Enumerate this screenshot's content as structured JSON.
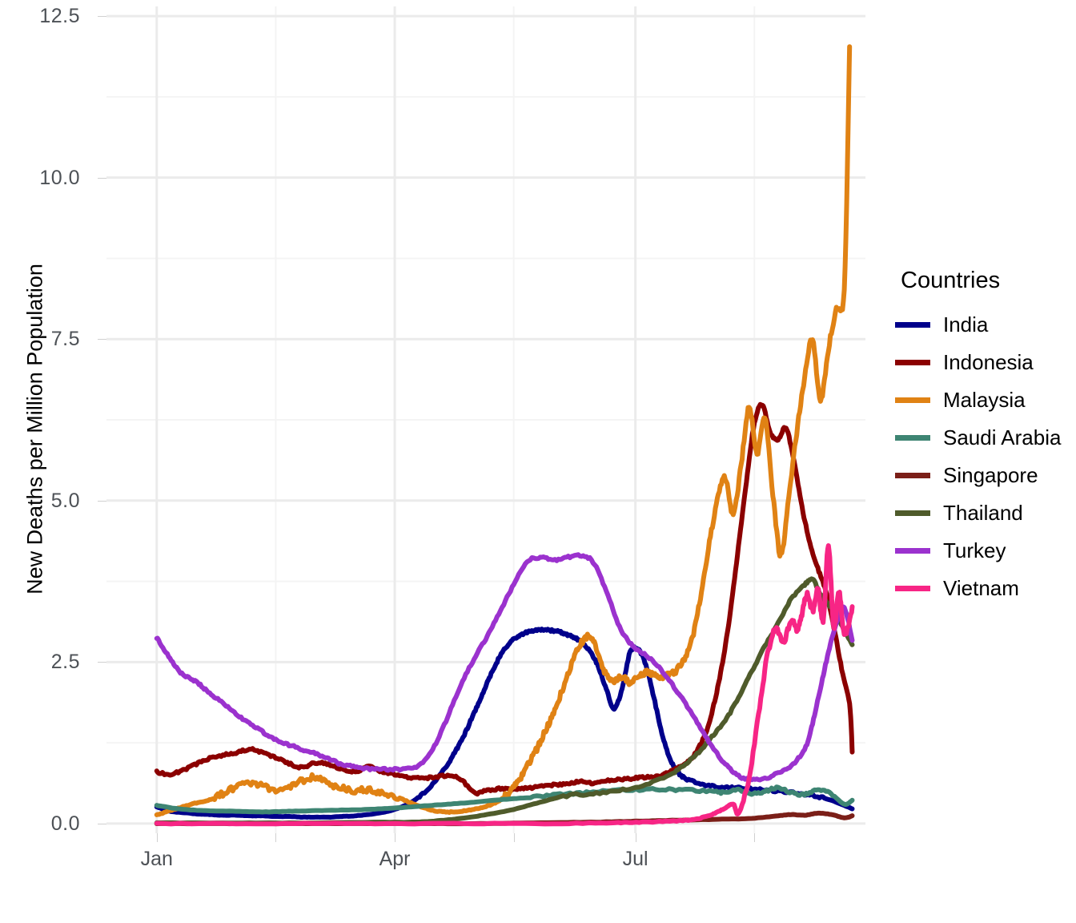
{
  "chart_data": {
    "type": "line",
    "title": "",
    "xlabel": "",
    "ylabel": "New Deaths per Million Population",
    "ylim": [
      -0.15,
      12.65
    ],
    "yticks": [
      "0.0",
      "2.5",
      "5.0",
      "7.5",
      "10.0",
      "12.5"
    ],
    "ytick_values": [
      0.0,
      2.5,
      5.0,
      7.5,
      10.0,
      12.5
    ],
    "minor_ytick_values": [
      1.25,
      3.75,
      6.25,
      8.75,
      11.25
    ],
    "xticks": [
      "Jan",
      "Apr",
      "Jul"
    ],
    "xtick_positions": [
      0,
      90,
      181
    ],
    "minor_xtick_positions": [
      45,
      135,
      226
    ],
    "xlim": [
      -19,
      268
    ],
    "grid": true,
    "legend_position": "right",
    "legend_title": "Countries",
    "x_unit": "day of year",
    "series": [
      {
        "name": "India",
        "color": "#00008B",
        "x": [
          0,
          5,
          10,
          15,
          20,
          25,
          30,
          35,
          40,
          45,
          50,
          55,
          60,
          65,
          70,
          75,
          80,
          85,
          90,
          95,
          100,
          105,
          110,
          113,
          116,
          119,
          122,
          125,
          128,
          131,
          134,
          137,
          140,
          143,
          146,
          149,
          152,
          155,
          158,
          161,
          164,
          167,
          170,
          173,
          176,
          179,
          182,
          185,
          188,
          191,
          194,
          197,
          200,
          205,
          210,
          215,
          220,
          225,
          230,
          235,
          240,
          245,
          250,
          255,
          260,
          263
        ],
        "values": [
          0.26,
          0.19,
          0.17,
          0.15,
          0.14,
          0.13,
          0.13,
          0.12,
          0.12,
          0.11,
          0.11,
          0.1,
          0.1,
          0.1,
          0.11,
          0.12,
          0.14,
          0.17,
          0.22,
          0.3,
          0.44,
          0.64,
          0.92,
          1.12,
          1.35,
          1.62,
          1.9,
          2.18,
          2.45,
          2.67,
          2.82,
          2.91,
          2.96,
          2.99,
          3.0,
          2.99,
          2.97,
          2.93,
          2.88,
          2.8,
          2.66,
          2.42,
          2.08,
          1.78,
          2.1,
          2.65,
          2.7,
          2.45,
          1.95,
          1.4,
          1.02,
          0.8,
          0.7,
          0.62,
          0.58,
          0.56,
          0.55,
          0.54,
          0.52,
          0.5,
          0.48,
          0.45,
          0.42,
          0.36,
          0.28,
          0.23
        ]
      },
      {
        "name": "Indonesia",
        "color": "#8B0000",
        "x": [
          0,
          5,
          10,
          15,
          20,
          25,
          30,
          35,
          40,
          45,
          50,
          55,
          60,
          65,
          70,
          75,
          80,
          85,
          90,
          95,
          100,
          105,
          110,
          115,
          120,
          125,
          130,
          135,
          140,
          145,
          150,
          155,
          160,
          165,
          170,
          175,
          180,
          185,
          190,
          193,
          196,
          199,
          202,
          205,
          208,
          211,
          214,
          217,
          220,
          223,
          226,
          229,
          232,
          235,
          238,
          241,
          244,
          247,
          250,
          253,
          256,
          259,
          262,
          263
        ],
        "values": [
          0.8,
          0.76,
          0.83,
          0.92,
          1.01,
          1.06,
          1.09,
          1.15,
          1.1,
          1.02,
          0.93,
          0.87,
          0.94,
          0.92,
          0.84,
          0.8,
          0.88,
          0.81,
          0.76,
          0.72,
          0.7,
          0.72,
          0.74,
          0.69,
          0.48,
          0.51,
          0.54,
          0.53,
          0.55,
          0.57,
          0.6,
          0.62,
          0.65,
          0.63,
          0.66,
          0.68,
          0.7,
          0.72,
          0.74,
          0.78,
          0.84,
          0.9,
          1.0,
          1.18,
          1.45,
          1.9,
          2.5,
          3.3,
          4.3,
          5.3,
          6.2,
          6.48,
          6.05,
          5.95,
          6.12,
          5.6,
          4.9,
          4.35,
          3.95,
          3.6,
          3.05,
          2.4,
          1.85,
          1.12
        ]
      },
      {
        "name": "Malaysia",
        "color": "#E08214",
        "x": [
          0,
          5,
          10,
          15,
          20,
          25,
          30,
          35,
          40,
          45,
          50,
          55,
          60,
          65,
          70,
          75,
          80,
          85,
          90,
          95,
          100,
          105,
          110,
          115,
          120,
          124,
          128,
          131,
          134,
          137,
          140,
          143,
          146,
          149,
          152,
          155,
          158,
          161,
          164,
          167,
          170,
          173,
          176,
          179,
          182,
          185,
          188,
          191,
          194,
          197,
          200,
          203,
          206,
          209,
          212,
          215,
          218,
          221,
          224,
          227,
          230,
          233,
          236,
          239,
          242,
          245,
          248,
          251,
          254,
          257,
          260,
          262
        ],
        "values": [
          0.13,
          0.2,
          0.26,
          0.32,
          0.37,
          0.46,
          0.56,
          0.62,
          0.58,
          0.52,
          0.58,
          0.66,
          0.72,
          0.62,
          0.55,
          0.5,
          0.53,
          0.48,
          0.42,
          0.34,
          0.26,
          0.2,
          0.18,
          0.19,
          0.22,
          0.26,
          0.32,
          0.4,
          0.52,
          0.68,
          0.88,
          1.1,
          1.35,
          1.62,
          1.92,
          2.25,
          2.6,
          2.82,
          2.9,
          2.62,
          2.3,
          2.2,
          2.28,
          2.18,
          2.28,
          2.34,
          2.32,
          2.28,
          2.3,
          2.4,
          2.6,
          2.95,
          3.6,
          4.35,
          5.0,
          5.35,
          4.8,
          5.55,
          6.45,
          5.7,
          6.3,
          5.1,
          4.15,
          5.05,
          6.05,
          6.9,
          7.5,
          6.55,
          7.35,
          7.95,
          8.3,
          12.05
        ]
      },
      {
        "name": "Saudi Arabia",
        "color": "#3E8573",
        "x": [
          0,
          10,
          20,
          30,
          40,
          50,
          60,
          70,
          80,
          90,
          100,
          110,
          120,
          130,
          140,
          150,
          160,
          170,
          180,
          190,
          200,
          210,
          215,
          220,
          225,
          230,
          235,
          240,
          245,
          250,
          255,
          260,
          263
        ],
        "values": [
          0.28,
          0.22,
          0.2,
          0.19,
          0.18,
          0.19,
          0.2,
          0.21,
          0.22,
          0.24,
          0.27,
          0.3,
          0.33,
          0.37,
          0.4,
          0.44,
          0.47,
          0.5,
          0.52,
          0.53,
          0.52,
          0.5,
          0.48,
          0.52,
          0.46,
          0.5,
          0.55,
          0.48,
          0.45,
          0.52,
          0.46,
          0.3,
          0.36
        ]
      },
      {
        "name": "Singapore",
        "color": "#7B1F18",
        "x": [
          0,
          20,
          40,
          60,
          80,
          100,
          120,
          140,
          160,
          175,
          185,
          195,
          205,
          215,
          225,
          235,
          240,
          245,
          250,
          255,
          260,
          263
        ],
        "values": [
          0.0,
          0.0,
          0.0,
          0.0,
          0.0,
          0.0,
          0.0,
          0.01,
          0.02,
          0.03,
          0.04,
          0.05,
          0.06,
          0.07,
          0.08,
          0.12,
          0.14,
          0.13,
          0.16,
          0.14,
          0.09,
          0.12
        ]
      },
      {
        "name": "Thailand",
        "color": "#4F5B2B",
        "x": [
          0,
          20,
          40,
          60,
          80,
          95,
          105,
          115,
          125,
          135,
          145,
          155,
          165,
          175,
          185,
          195,
          200,
          205,
          210,
          215,
          220,
          225,
          230,
          235,
          240,
          245,
          248,
          251,
          254,
          257,
          260,
          263
        ],
        "values": [
          0.01,
          0.01,
          0.01,
          0.01,
          0.02,
          0.02,
          0.04,
          0.08,
          0.14,
          0.22,
          0.33,
          0.43,
          0.46,
          0.52,
          0.6,
          0.78,
          0.92,
          1.1,
          1.35,
          1.6,
          1.95,
          2.35,
          2.75,
          3.1,
          3.48,
          3.7,
          3.78,
          3.55,
          3.4,
          3.25,
          3.0,
          2.78
        ]
      },
      {
        "name": "Turkey",
        "color": "#9B32CE",
        "x": [
          0,
          4,
          8,
          12,
          16,
          20,
          25,
          30,
          35,
          40,
          45,
          50,
          55,
          60,
          65,
          70,
          75,
          80,
          85,
          90,
          95,
          100,
          105,
          110,
          115,
          120,
          125,
          130,
          135,
          140,
          145,
          150,
          155,
          160,
          165,
          170,
          175,
          180,
          185,
          190,
          195,
          200,
          205,
          210,
          215,
          220,
          225,
          230,
          235,
          240,
          245,
          248,
          251,
          254,
          257,
          260,
          263
        ],
        "values": [
          2.88,
          2.62,
          2.38,
          2.26,
          2.16,
          2.02,
          1.86,
          1.7,
          1.55,
          1.42,
          1.3,
          1.22,
          1.15,
          1.08,
          1.0,
          0.92,
          0.88,
          0.85,
          0.84,
          0.84,
          0.86,
          0.92,
          1.2,
          1.65,
          2.15,
          2.55,
          2.9,
          3.3,
          3.7,
          4.05,
          4.12,
          4.08,
          4.12,
          4.15,
          4.05,
          3.6,
          3.05,
          2.75,
          2.6,
          2.42,
          2.15,
          1.85,
          1.52,
          1.2,
          0.92,
          0.74,
          0.68,
          0.7,
          0.78,
          0.9,
          1.15,
          1.55,
          2.1,
          2.65,
          3.1,
          3.35,
          2.82
        ]
      },
      {
        "name": "Vietnam",
        "color": "#F72585",
        "x": [
          0,
          30,
          60,
          90,
          120,
          150,
          170,
          180,
          190,
          200,
          205,
          210,
          214,
          218,
          220,
          224,
          228,
          231,
          234,
          237,
          240,
          242,
          244,
          246,
          248,
          250,
          252,
          254,
          256,
          258,
          260,
          263
        ],
        "values": [
          0.0,
          0.0,
          0.0,
          0.0,
          0.0,
          0.0,
          0.01,
          0.02,
          0.03,
          0.05,
          0.08,
          0.14,
          0.22,
          0.3,
          0.16,
          0.7,
          1.8,
          2.62,
          3.0,
          2.82,
          3.15,
          3.0,
          3.25,
          3.55,
          3.3,
          3.62,
          3.15,
          4.28,
          3.05,
          3.58,
          2.95,
          3.32
        ]
      }
    ]
  },
  "axes": {
    "y_title": "New Deaths per Million Population",
    "y_ticks": [
      {
        "label": "12.5",
        "value": 12.5
      },
      {
        "label": "10.0",
        "value": 10.0
      },
      {
        "label": "7.5",
        "value": 7.5
      },
      {
        "label": "5.0",
        "value": 5.0
      },
      {
        "label": "2.5",
        "value": 2.5
      },
      {
        "label": "0.0",
        "value": 0.0
      }
    ],
    "x_ticks": [
      {
        "label": "Jan",
        "value": 0
      },
      {
        "label": "Apr",
        "value": 90
      },
      {
        "label": "Jul",
        "value": 181
      }
    ]
  },
  "legend": {
    "title": "Countries",
    "items": [
      {
        "label": "India",
        "color": "#00008B"
      },
      {
        "label": "Indonesia",
        "color": "#8B0000"
      },
      {
        "label": "Malaysia",
        "color": "#E08214"
      },
      {
        "label": "Saudi Arabia",
        "color": "#3E8573"
      },
      {
        "label": "Singapore",
        "color": "#7B1F18"
      },
      {
        "label": "Thailand",
        "color": "#4F5B2B"
      },
      {
        "label": "Turkey",
        "color": "#9B32CE"
      },
      {
        "label": "Vietnam",
        "color": "#F72585"
      }
    ]
  },
  "style": {
    "panel_background": "#FFFFFF",
    "major_gridline_color": "#EBEBEB",
    "minor_gridline_color": "#F4F4F4",
    "tick_label_color": "#4D5156",
    "axis_title_color": "#000000"
  }
}
